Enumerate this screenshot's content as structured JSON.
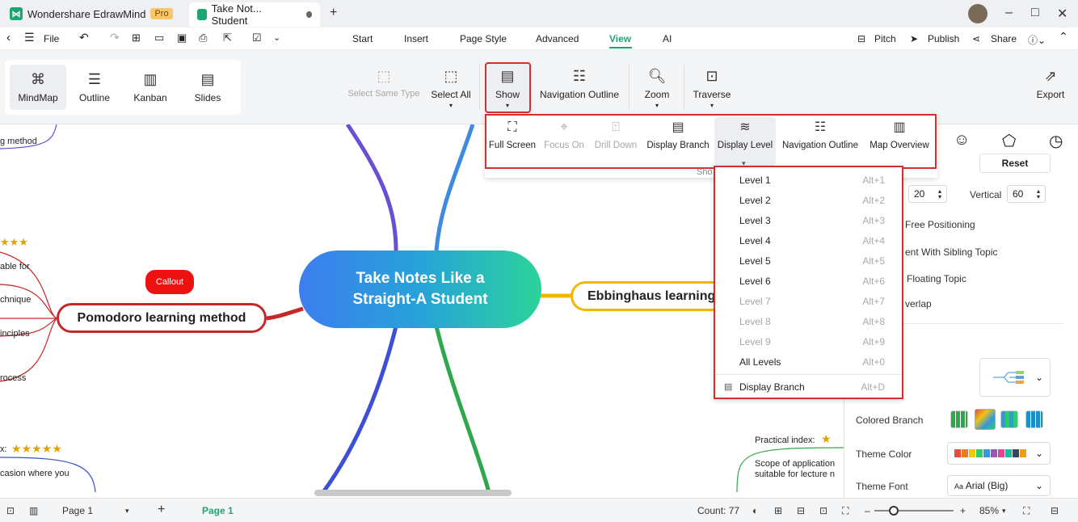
{
  "titlebar": {
    "app_name": "Wondershare EdrawMind",
    "pro_badge": "Pro",
    "doc_tab": "Take Not... Student",
    "add_tab_glyph": "+",
    "minimize_glyph": "–",
    "maximize_glyph": "□",
    "close_glyph": "✕"
  },
  "menubar": {
    "file_label": "File",
    "tabs": [
      "Start",
      "Insert",
      "Page Style",
      "Advanced",
      "View",
      "AI"
    ],
    "active_tab": "View",
    "pitch_label": "Pitch",
    "publish_label": "Publish",
    "share_label": "Share"
  },
  "ribbon": {
    "views": [
      "MindMap",
      "Outline",
      "Kanban",
      "Slides"
    ],
    "select_same_type": "Select Same Type",
    "select_all": "Select All",
    "show": "Show",
    "navigation_outline": "Navigation Outline",
    "zoom": "Zoom",
    "traverse": "Traverse",
    "export": "Export"
  },
  "show_panel": {
    "items": [
      "Full Screen",
      "Focus On",
      "Drill Down",
      "Display Branch",
      "Display Level",
      "Navigation Outline",
      "Map Overview"
    ],
    "footer_label": "Sho"
  },
  "level_menu": {
    "items": [
      {
        "label": "Level 1",
        "key": "Alt+1",
        "enabled": true
      },
      {
        "label": "Level 2",
        "key": "Alt+2",
        "enabled": true
      },
      {
        "label": "Level 3",
        "key": "Alt+3",
        "enabled": true
      },
      {
        "label": "Level 4",
        "key": "Alt+4",
        "enabled": true
      },
      {
        "label": "Level 5",
        "key": "Alt+5",
        "enabled": true
      },
      {
        "label": "Level 6",
        "key": "Alt+6",
        "enabled": true
      },
      {
        "label": "Level 7",
        "key": "Alt+7",
        "enabled": false
      },
      {
        "label": "Level 8",
        "key": "Alt+8",
        "enabled": false
      },
      {
        "label": "Level 9",
        "key": "Alt+9",
        "enabled": false
      },
      {
        "label": "All Levels",
        "key": "Alt+0",
        "enabled": true
      },
      {
        "label": "Display Branch",
        "key": "Alt+D",
        "enabled": true
      }
    ]
  },
  "canvas": {
    "central_line1": "Take Notes Like a",
    "central_line2": "Straight-A Student",
    "pomodoro": "Pomodoro learning method",
    "ebbinghaus": "Ebbinghaus learning",
    "callout": "Callout",
    "left_labels": [
      "g method",
      "able for",
      "chnique",
      "inciples",
      "rocess"
    ],
    "left_bottom_label": "x:",
    "left_bottom_text": "casion where you",
    "practical_index": "Practical index:",
    "scope_line1": "Scope of application",
    "scope_line2": "suitable for lecture n"
  },
  "right_panel": {
    "reset": "Reset",
    "horizontal_value": "20",
    "vertical_label": "Vertical",
    "vertical_value": "60",
    "opt1": "Free Positioning",
    "opt2": "ent With Sibling Topic",
    "opt3": "Floating Topic",
    "opt4": "verlap",
    "colored_branch": "Colored Branch",
    "theme_color": "Theme Color",
    "theme_font": "Theme Font",
    "theme_font_value": "Arial (Big)",
    "palette": [
      "#e74c3c",
      "#e67e22",
      "#f1c40f",
      "#2ecc71",
      "#3498db",
      "#9b59b6",
      "#e84393",
      "#1abc9c",
      "#34495e",
      "#f39c12"
    ]
  },
  "statusbar": {
    "page_select": "Page 1",
    "page_tab": "Page 1",
    "count": "Count: 77",
    "zoom": "85%"
  },
  "colors": {
    "accent": "#1ea672",
    "highlight": "#d32f2f"
  }
}
